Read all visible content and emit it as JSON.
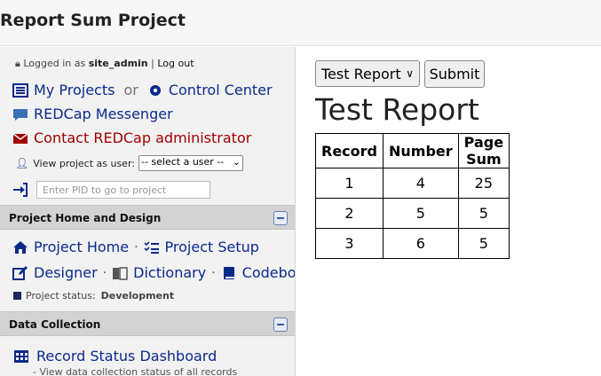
{
  "header": {
    "title": "Report Sum Project"
  },
  "sidebar": {
    "logged_in_prefix": "Logged in as",
    "username": "site_admin",
    "separator": "|",
    "logout": "Log out",
    "my_projects": "My Projects",
    "or": "or",
    "control_center": "Control Center",
    "messenger": "REDCap Messenger",
    "contact_admin": "Contact REDCap administrator",
    "view_as_label": "View project as user:",
    "view_as_selected": "-- select a user --",
    "pid_placeholder": "Enter PID to go to project",
    "section_home": "Project Home and Design",
    "project_home": "Project Home",
    "project_setup": "Project Setup",
    "designer": "Designer",
    "dictionary": "Dictionary",
    "codebook": "Codebook",
    "status_label": "Project status:",
    "status_value": "Development",
    "section_collection": "Data Collection",
    "record_status": "Record Status Dashboard",
    "record_status_sub": "- View data collection status of all records"
  },
  "main": {
    "report_selected": "Test Report",
    "submit_label": "Submit",
    "report_title": "Test Report",
    "table": {
      "headers": [
        "Record",
        "Number",
        "Page Sum"
      ],
      "rows": [
        [
          "1",
          "4",
          "25"
        ],
        [
          "2",
          "5",
          "5"
        ],
        [
          "3",
          "6",
          "5"
        ]
      ]
    }
  },
  "colors": {
    "link": "#0a2a8a",
    "contact": "#a00000",
    "section_bg": "#d3d3d3"
  }
}
